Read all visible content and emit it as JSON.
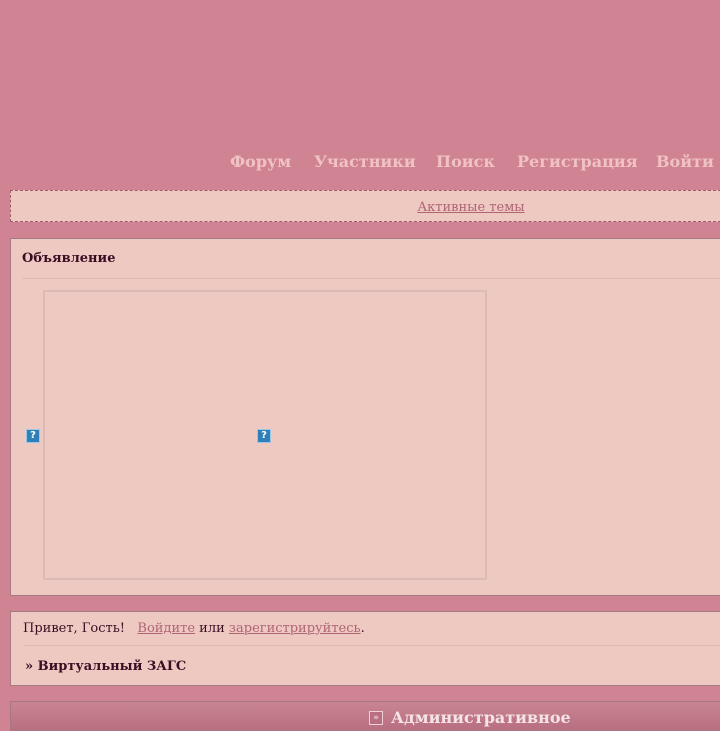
{
  "nav": {
    "items": [
      "Форум",
      "Участники",
      "Поиск",
      "Регистрация",
      "Войти"
    ]
  },
  "active_topics": {
    "label": "Активные темы"
  },
  "announcement": {
    "title": "Объявление",
    "broken_image_icon": "broken-image-icon"
  },
  "welcome": {
    "greeting": "Привет, Гость!",
    "login_link": "Войдите",
    "or": "или",
    "register_link": "зарегистрируйтесь",
    "period": "."
  },
  "breadcrumb": {
    "text": "» Виртуальный ЗАГС"
  },
  "category": {
    "icon": "double-chevron-icon",
    "title": "Административное"
  },
  "colors": {
    "background": "#d08392",
    "panel": "#edc9c2",
    "nav_text": "#f0c2c6",
    "link": "#b06474",
    "text": "#3b0c22"
  }
}
